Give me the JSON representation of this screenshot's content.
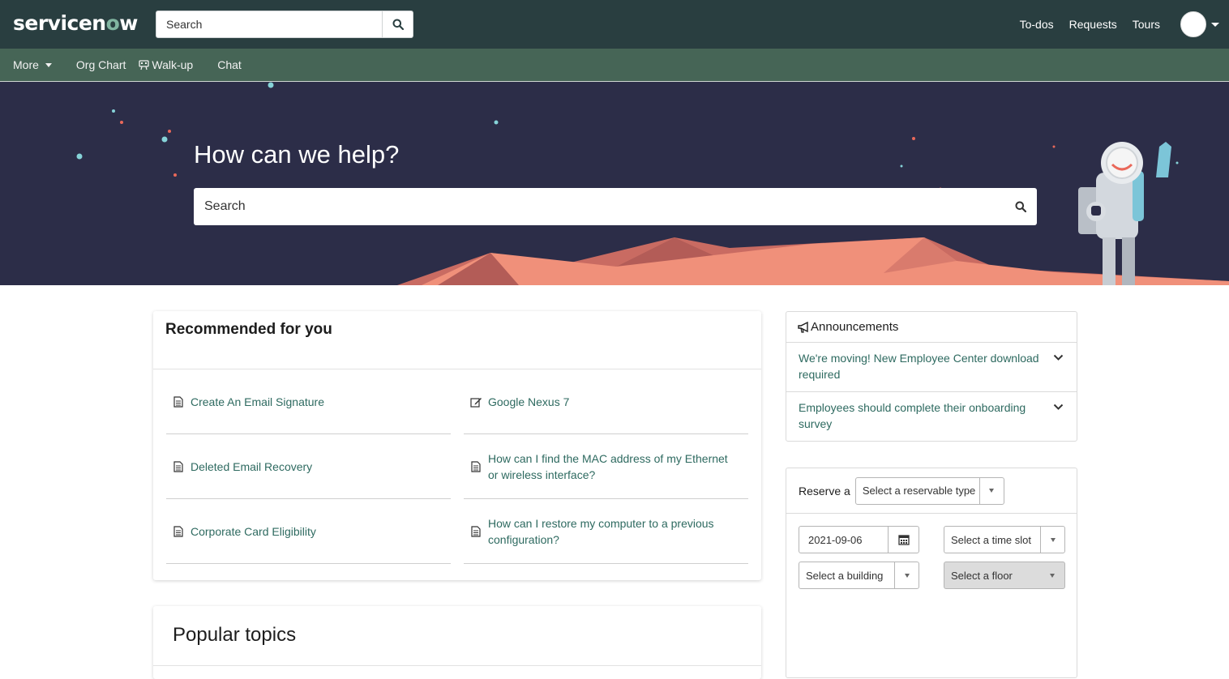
{
  "header": {
    "logo_main": "servicen",
    "logo_o": "o",
    "logo_tail": "w",
    "search_placeholder": "Search",
    "links": [
      "To-dos",
      "Requests",
      "Tours"
    ]
  },
  "subnav": {
    "more": "More",
    "org_chart": "Org Chart",
    "walkup": "Walk-up",
    "chat": "Chat"
  },
  "hero": {
    "title": "How can we help?",
    "search_placeholder": "Search"
  },
  "recommended": {
    "title": "Recommended for you",
    "items": [
      {
        "label": "Create An Email Signature",
        "icon": "document-icon"
      },
      {
        "label": "Google Nexus 7",
        "icon": "edit-form-icon"
      },
      {
        "label": "Deleted Email Recovery",
        "icon": "document-icon"
      },
      {
        "label": "How can I find the MAC address of my Ethernet or wireless interface?",
        "icon": "document-icon"
      },
      {
        "label": "Corporate Card Eligibility",
        "icon": "document-icon"
      },
      {
        "label": "How can I restore my computer to a previous configuration?",
        "icon": "document-icon"
      }
    ]
  },
  "popular": {
    "title": "Popular topics"
  },
  "announcements": {
    "title": "Announcements",
    "items": [
      {
        "label": "We're moving! New Employee Center download required"
      },
      {
        "label": "Employees should complete their onboarding survey"
      }
    ]
  },
  "reserve": {
    "label": "Reserve a",
    "type_placeholder": "Select a reservable type",
    "date_value": "2021-09-06",
    "time_placeholder": "Select a time slot",
    "building_placeholder": "Select a building",
    "floor_placeholder": "Select a floor"
  },
  "colors": {
    "header_bg": "#293e40",
    "subnav_bg": "#466556",
    "hero_bg": "#2c2d48",
    "link": "#2e6a60",
    "mountain": "#f0907a"
  }
}
